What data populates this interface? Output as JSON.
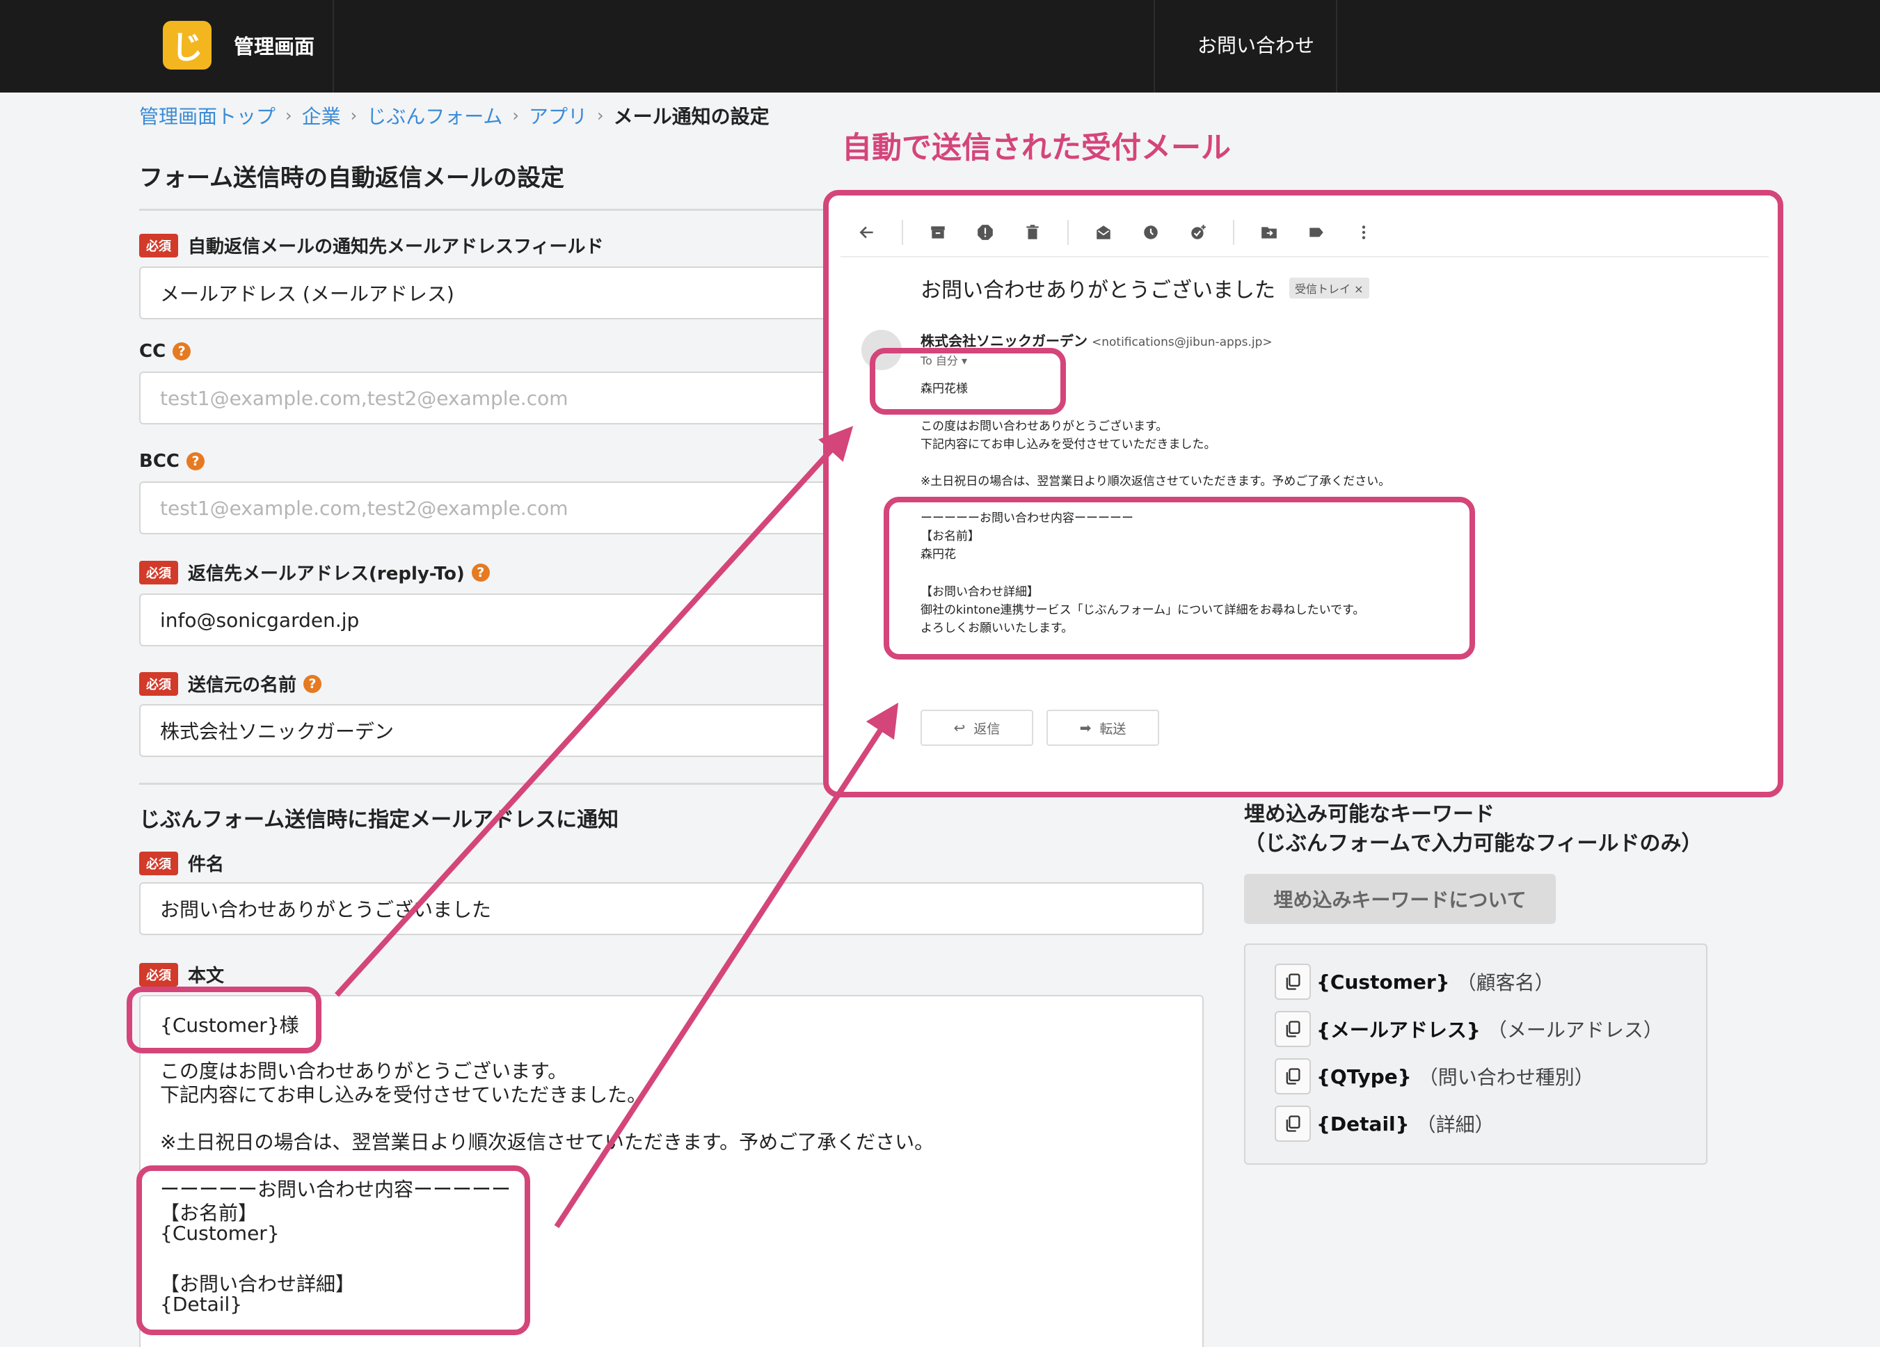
{
  "header": {
    "logo_glyph": "じ",
    "app_title": "管理画面",
    "contact_link": "お問い合わせ"
  },
  "breadcrumb": [
    {
      "label": "管理画面トップ",
      "current": false
    },
    {
      "label": "企業",
      "current": false
    },
    {
      "label": "じぶんフォーム",
      "current": false
    },
    {
      "label": "アプリ",
      "current": false
    },
    {
      "label": "メール通知の設定",
      "current": true
    }
  ],
  "breadcrumb_separator": "›",
  "auto_reply": {
    "title": "フォーム送信時の自動返信メールの設定",
    "required_badge": "必須",
    "help_glyph": "?",
    "fields": {
      "to_field": {
        "label": "自動返信メールの通知先メールアドレスフィールド",
        "value": "メールアドレス (メールアドレス)"
      },
      "cc": {
        "label": "CC",
        "placeholder": "test1@example.com,test2@example.com"
      },
      "bcc": {
        "label": "BCC",
        "placeholder": "test1@example.com,test2@example.com"
      },
      "reply_to": {
        "label": "返信先メールアドレス(reply-To)",
        "value": "info@sonicgarden.jp"
      },
      "sender_name": {
        "label": "送信元の名前",
        "value": "株式会社ソニックガーデン"
      }
    }
  },
  "notify": {
    "title": "じぶんフォーム送信時に指定メールアドレスに通知",
    "subject": {
      "label": "件名",
      "value": "お問い合わせありがとうございました"
    },
    "body": {
      "label": "本文",
      "lines": [
        "{Customer}様",
        "この度はお問い合わせありがとうございます。",
        "下記内容にてお申し込みを受付させていただきました。",
        "※土日祝日の場合は、翌営業日より順次返信させていただきます。予めご了承ください。",
        "ーーーーーお問い合わせ内容ーーーーー",
        "【お名前】",
        "{Customer}",
        "【お問い合わせ詳細】",
        "{Detail}"
      ]
    }
  },
  "keywords": {
    "title_line1": "埋め込み可能なキーワード",
    "title_line2": "（じぶんフォームで入力可能なフィールドのみ）",
    "about_button": "埋め込みキーワードについて",
    "items": [
      {
        "token": "{Customer}",
        "desc": "（顧客名）"
      },
      {
        "token": "{メールアドレス}",
        "desc": "（メールアドレス）"
      },
      {
        "token": "{QType}",
        "desc": "（問い合わせ種別）"
      },
      {
        "token": "{Detail}",
        "desc": "（詳細）"
      }
    ]
  },
  "annotation": {
    "title": "自動で送信された受付メール",
    "color": "#d4457a"
  },
  "email_preview": {
    "subject": "お問い合わせありがとうございました",
    "inbox_tag": "受信トレイ ×",
    "sender_name": "株式会社ソニックガーデン",
    "sender_address": "<notifications@jibun-apps.jp>",
    "to": "To 自分 ▾",
    "lines": [
      "森円花様",
      "この度はお問い合わせありがとうございます。",
      "下記内容にてお申し込みを受付させていただきました。",
      "※土日祝日の場合は、翌営業日より順次返信させていただきます。予めご了承ください。",
      "ーーーーーお問い合わせ内容ーーーーー",
      "【お名前】",
      "森円花",
      "【お問い合わせ詳細】",
      "御社のkintone連携サービス「じぶんフォーム」について詳細をお尋ねしたいです。",
      "よろしくお願いいたします。"
    ],
    "reply_button": "返信",
    "forward_button": "転送",
    "toolbar_icons": [
      "back-arrow-icon",
      "archive-icon",
      "report-spam-icon",
      "delete-icon",
      "mark-unread-icon",
      "snooze-icon",
      "add-task-icon",
      "move-to-icon",
      "label-icon",
      "more-icon"
    ]
  }
}
